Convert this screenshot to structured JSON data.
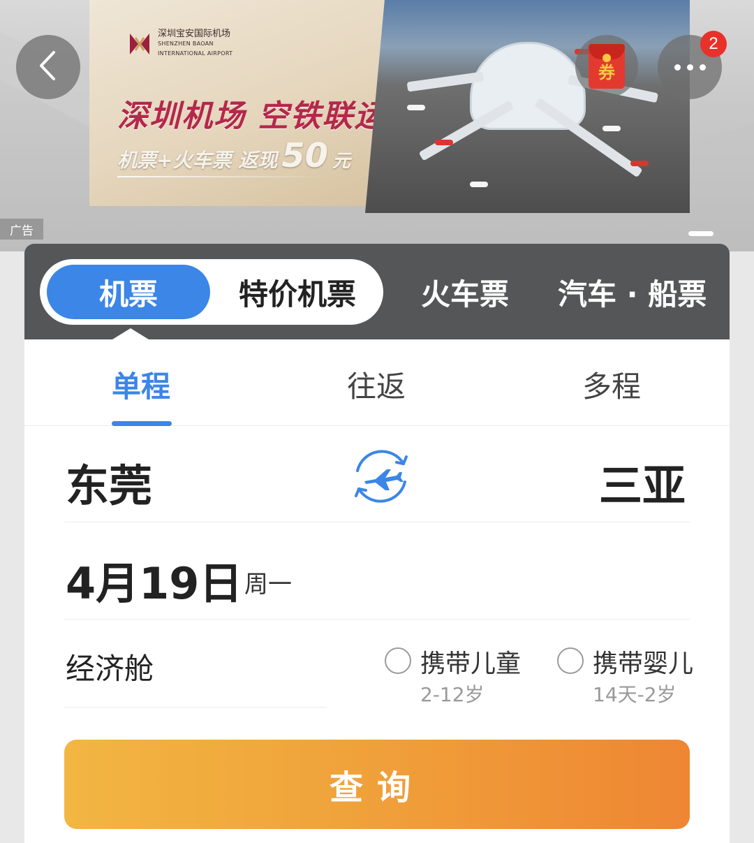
{
  "banner": {
    "logo_cn": "深圳宝安国际机场",
    "logo_en_1": "SHENZHEN BAOAN",
    "logo_en_2": "INTERNATIONAL AIRPORT",
    "headline": "深圳机场 空铁联运",
    "sub_prefix": "机票+火车票 返现",
    "sub_amount": "50",
    "sub_unit": "元",
    "ad_label": "广告"
  },
  "header": {
    "back_icon": "chevron-left-icon",
    "coupon_label": "券",
    "more_icon": "more-dots-icon",
    "notification_count": "2"
  },
  "product_tabs": {
    "items": [
      "机票",
      "特价机票",
      "火车票",
      "汽车 · 船票"
    ],
    "active": "机票"
  },
  "trip_tabs": {
    "items": [
      "单程",
      "往返",
      "多程"
    ],
    "active": "单程"
  },
  "route": {
    "from": "东莞",
    "to": "三亚",
    "swap_icon": "plane-swap-icon"
  },
  "date": {
    "main": "4月19日",
    "weekday": "周一"
  },
  "cabin": {
    "value": "经济舱"
  },
  "passengers": {
    "child_label": "携带儿童",
    "child_age": "2-12岁",
    "infant_label": "携带婴儿",
    "infant_age": "14天-2岁"
  },
  "search": {
    "label": "查询"
  },
  "colors": {
    "accent_blue": "#3b86e6",
    "tab_bar": "#555657",
    "search_start": "#f2b642",
    "search_end": "#ee8633",
    "badge_red": "#e8312a",
    "ad_headline": "#b4284a"
  }
}
